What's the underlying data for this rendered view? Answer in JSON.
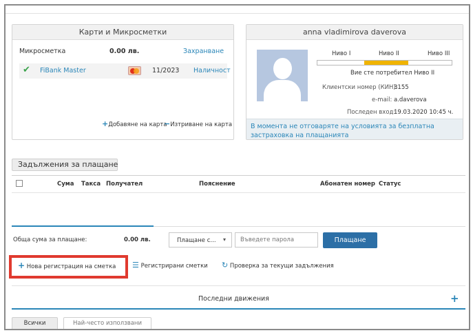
{
  "cards": {
    "title": "Карти и Микросметки",
    "microaccount_label": "Микросметка",
    "microaccount_amount": "0.00 лв.",
    "microaccount_action": "Захранване",
    "card_name": "FiBank Master",
    "card_expiry": "11/2023",
    "card_action": "Наличност",
    "add_card": "Добавяне на карта",
    "remove_card": "Изтриване на карта"
  },
  "profile": {
    "name": "anna vladimirova daverova",
    "levels": [
      "Ниво I",
      "Ниво II",
      "Ниво III"
    ],
    "level_status": "Вие сте потребител Ниво II",
    "client_no_label": "Клиентски номер (КИН):",
    "client_no": "3155",
    "email_label": "e-mail:",
    "email": "a.daverova",
    "last_login_label": "Последен вход:",
    "last_login": "19.03.2020 10:45 ч.",
    "notice": "В момента не отговаряте на условията за безплатна застраховка на плащанията"
  },
  "bills": {
    "title_button": "Задължения за плащане",
    "columns": [
      "Сума",
      "Такса",
      "Получател",
      "Пояснение",
      "Абонатен номер",
      "Статус"
    ],
    "total_label": "Обща сума за плащане:",
    "total_value": "0.00 лв.",
    "pay_select": "Плащане с...",
    "password_placeholder": "Въведете парола",
    "pay_button": "Плащане"
  },
  "actions": {
    "new_registration": "Нова регистрация на сметка",
    "registered": "Регистрирани сметки",
    "check": "Проверка за текущи задължения"
  },
  "movements": {
    "title": "Последни движения",
    "tab_all": "Всички",
    "tab_frequent": "Най-често използвани"
  },
  "colors": {
    "accent": "#2a86b8",
    "check_green": "#3aa24a",
    "level_bar": "#f0b400",
    "pay_button": "#2c6fa6",
    "highlight": "#e03a2f",
    "notice_bg": "#e9eff3"
  }
}
